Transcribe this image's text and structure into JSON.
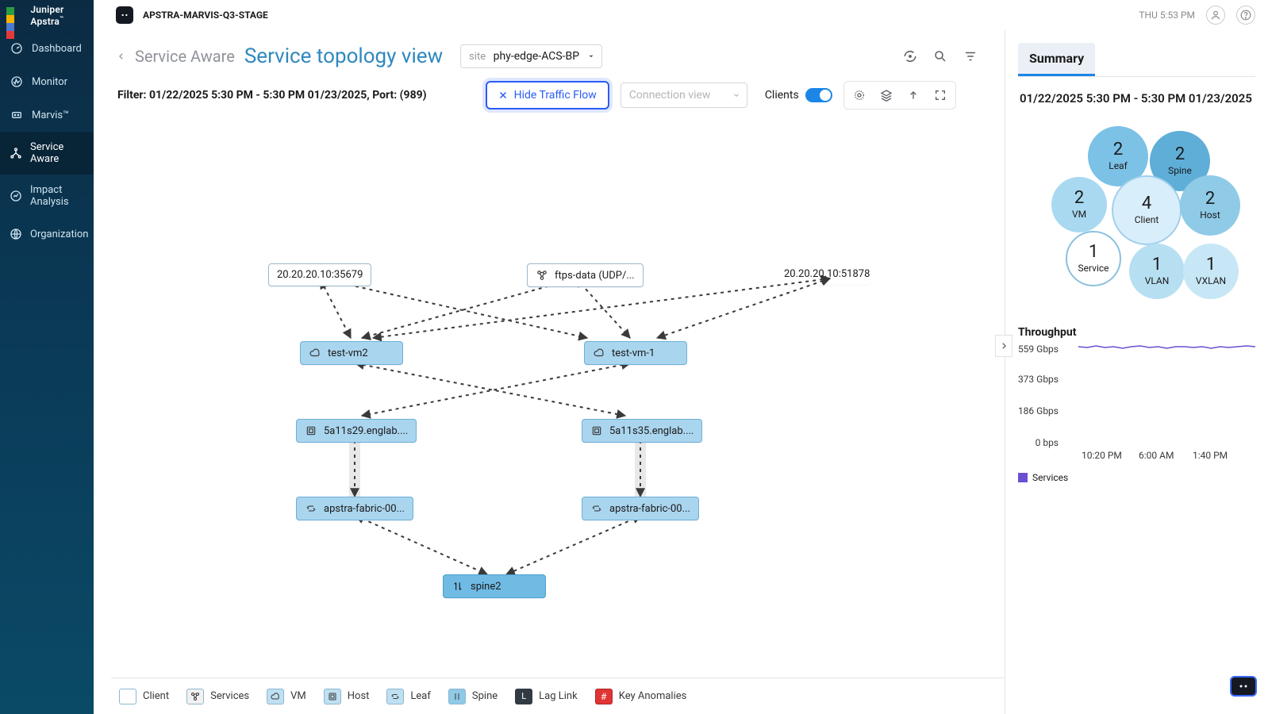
{
  "brand": {
    "name": "Juniper Apstra",
    "tm": "™"
  },
  "env": {
    "name": "APSTRA-MARVIS-Q3-STAGE"
  },
  "topright": {
    "time": "THU 5:53 PM"
  },
  "sidebar": {
    "items": [
      {
        "label": "Dashboard"
      },
      {
        "label": "Monitor"
      },
      {
        "label": "Marvis™"
      },
      {
        "label": "Service Aware"
      },
      {
        "label": "Impact Analysis"
      },
      {
        "label": "Organization"
      }
    ]
  },
  "breadcrumb": {
    "parent": "Service Aware",
    "title": "Service topology view"
  },
  "siteSelect": {
    "label": "site",
    "value": "phy-edge-ACS-BP"
  },
  "filter": {
    "text": "Filter: 01/22/2025 5:30 PM - 5:30 PM 01/23/2025, Port: (989)",
    "hideTraffic": "Hide Traffic Flow",
    "connPlaceholder": "Connection view",
    "clientsLabel": "Clients"
  },
  "nodes": {
    "client1": "20.20.20.10:35679",
    "client2": "20.20.20.10:51878",
    "service": "ftps-data (UDP/...",
    "vm1": "test-vm2",
    "vm2": "test-vm-1",
    "host1": "5a11s29.englab....",
    "host2": "5a11s35.englab....",
    "leaf1": "apstra-fabric-00...",
    "leaf2": "apstra-fabric-00...",
    "spine": "spine2"
  },
  "legend": {
    "client": "Client",
    "services": "Services",
    "vm": "VM",
    "host": "Host",
    "leaf": "Leaf",
    "spine": "Spine",
    "lag": "Lag Link",
    "anom": "Key Anomalies",
    "lagLetter": "L",
    "anomHash": "#"
  },
  "summary": {
    "tab": "Summary",
    "range": "01/22/2025 5:30 PM - 5:30 PM 01/23/2025",
    "bubbles": {
      "leaf": {
        "n": "2",
        "l": "Leaf"
      },
      "spine": {
        "n": "2",
        "l": "Spine"
      },
      "vm": {
        "n": "2",
        "l": "VM"
      },
      "client": {
        "n": "4",
        "l": "Client"
      },
      "host": {
        "n": "2",
        "l": "Host"
      },
      "service": {
        "n": "1",
        "l": "Service"
      },
      "vlan": {
        "n": "1",
        "l": "VLAN"
      },
      "vxlan": {
        "n": "1",
        "l": "VXLAN"
      }
    },
    "throughputTitle": "Throughput",
    "yticks": [
      "559 Gbps",
      "373 Gbps",
      "186 Gbps",
      "0 bps"
    ],
    "xticks": [
      "10:20 PM",
      "6:00 AM",
      "1:40 PM"
    ],
    "legend": "Services"
  },
  "chart_data": {
    "type": "line",
    "title": "Throughput",
    "xlabel": "",
    "ylabel": "",
    "ylim": [
      0,
      559
    ],
    "xlim_labels": [
      "10:20 PM",
      "6:00 AM",
      "1:40 PM"
    ],
    "y_unit": "Gbps",
    "series": [
      {
        "name": "Services",
        "values": [
          555,
          552,
          556,
          553,
          555,
          551,
          554,
          556,
          553,
          555,
          552,
          554,
          555,
          553,
          555,
          552,
          554,
          553,
          555,
          556
        ]
      }
    ]
  }
}
